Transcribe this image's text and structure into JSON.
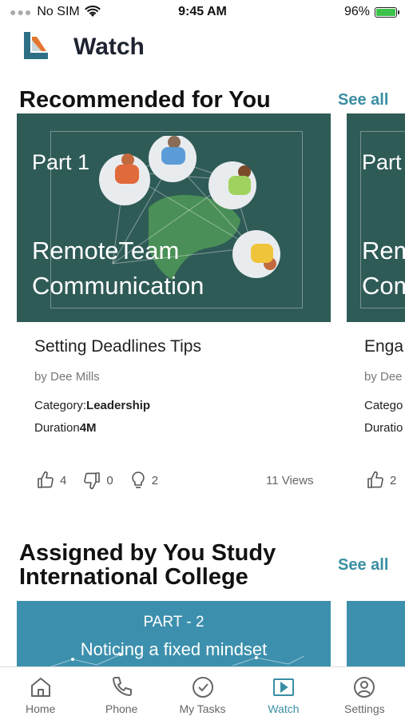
{
  "status_bar": {
    "carrier": "No SIM",
    "time": "9:45 AM",
    "battery": "96%"
  },
  "header": {
    "title": "Watch"
  },
  "recommended": {
    "title": "Recommended for You",
    "see_all": "See all",
    "card": {
      "thumb_part": "Part 1",
      "thumb_title_line1": "RemoteTeam",
      "thumb_title_line2": "Communication",
      "title": "Setting Deadlines Tips",
      "author": "by Dee Mills",
      "category_label": "Category:",
      "category_value": "Leadership",
      "duration_label": "Duration",
      "duration_value": "4M",
      "likes": "4",
      "dislikes": "0",
      "ideas": "2",
      "views": "11 Views"
    },
    "next_card": {
      "thumb_part": "Part",
      "thumb_title_line1": "Rem",
      "thumb_title_line2": "Com",
      "title": "Enga",
      "author": "by Dee",
      "category_label": "Catego",
      "duration_label": "Duratio",
      "likes": "2"
    }
  },
  "assigned": {
    "title_line1": "Assigned by You Study",
    "title_line2": "International College",
    "see_all": "See all",
    "card": {
      "thumb_part": "PART - 2",
      "thumb_title": "Noticing a fixed mindset"
    }
  },
  "tabbar": {
    "items": [
      {
        "label": "Home",
        "icon": "home-icon"
      },
      {
        "label": "Phone",
        "icon": "phone-icon"
      },
      {
        "label": "My Tasks",
        "icon": "check-circle-icon"
      },
      {
        "label": "Watch",
        "icon": "video-icon",
        "active": true
      },
      {
        "label": "Settings",
        "icon": "user-circle-icon"
      }
    ]
  },
  "colors": {
    "accent": "#3a8ea3",
    "thumb_dark": "#2f5b57",
    "thumb_blue": "#3c90ad"
  }
}
